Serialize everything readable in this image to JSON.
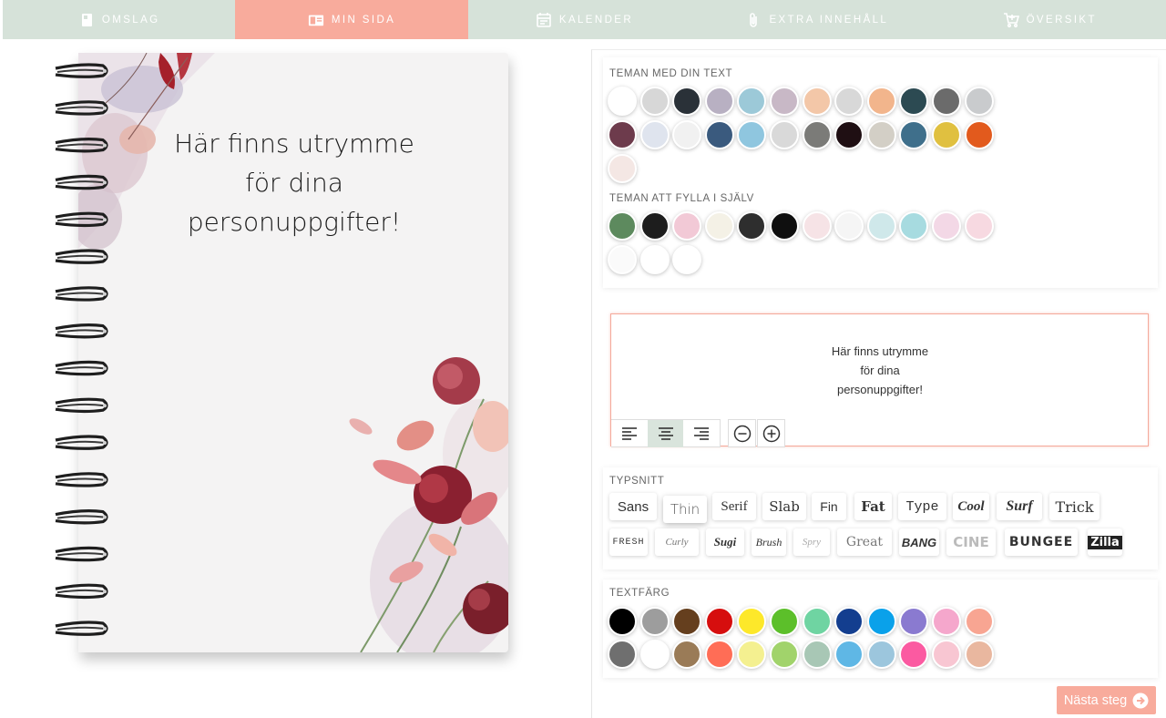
{
  "nav": {
    "tabs": [
      {
        "label": "OMSLAG",
        "icon": "book-icon"
      },
      {
        "label": "MIN SIDA",
        "icon": "page-icon",
        "active": true
      },
      {
        "label": "KALENDER",
        "icon": "calendar-icon"
      },
      {
        "label": "EXTRA INNEHÅLL",
        "icon": "paperclip-icon"
      },
      {
        "label": "ÖVERSIKT",
        "icon": "cart-icon"
      }
    ]
  },
  "notebook": {
    "cover_text": "Här finns utrymme\nför dina\npersonuppgifter!"
  },
  "themes": {
    "with_text_label": "TEMAN MED DIN TEXT",
    "with_text": [
      "#ffffff",
      "#d7d7d7",
      "#2a3138",
      "#b8b0c2",
      "#9cc9d8",
      "#c8b8c6",
      "#f3c7a8",
      "#d8d8d8",
      "#f2b58c",
      "#2c4a52",
      "#6b6b6b",
      "#c9cbcd",
      "#6d3b4c",
      "#dfe4ee",
      "#f1f1f1",
      "#3a5a7e",
      "#8fc6df",
      "#d9d9d9",
      "#7b7b78",
      "#1f0f13",
      "#d3cfc6",
      "#3f6f8b",
      "#e0c040",
      "#e25a1d",
      "#f4e7e4"
    ],
    "fill_in_label": "TEMAN ATT FYLLA I SJÄLV",
    "fill_in": [
      "#5d8a5e",
      "#1d1d1d",
      "#f2c9d6",
      "#f4f1e6",
      "#2e2e2e",
      "#0f0f0f",
      "#f6e3e6",
      "#f5f5f5",
      "#cfe8ea",
      "#a7dbe0",
      "#f3d8e6",
      "#f7d9e1",
      "#fafafa",
      "#ffffff",
      "#ffffff"
    ]
  },
  "editor": {
    "text": "Här finns utrymme\nför dina\npersonuppgifter!",
    "align_buttons": [
      "align-left-icon",
      "align-center-icon",
      "align-right-icon"
    ],
    "active_align": "center",
    "size_buttons": [
      "minus-icon",
      "plus-icon"
    ]
  },
  "fonts": {
    "label": "TYPSNITT",
    "row1": [
      "Sans",
      "Thin",
      "Serif",
      "Slab",
      "Fin",
      "Fat",
      "Type",
      "Cool",
      "Surf",
      "Trick"
    ],
    "row2": [
      "FRESH",
      "Curly",
      "Sugi",
      "Brush",
      "Spry",
      "Great",
      "BANG",
      "CINE",
      "BUNGEE",
      "Zilla"
    ],
    "selected": "Thin"
  },
  "text_colors": {
    "label": "TEXTFÄRG",
    "row1": [
      "#000000",
      "#9d9d9d",
      "#653f1e",
      "#d60e0e",
      "#fde82a",
      "#5cbf2a",
      "#6fd4a2",
      "#133e8f",
      "#0aa1ea",
      "#8a7ad0",
      "#f5a7cc",
      "#f8a592"
    ],
    "row2": [
      "#6f6f6f",
      "#ffffff",
      "#9a7b57",
      "#ff6d56",
      "#f4f090",
      "#a1d36b",
      "#a8c7b5",
      "#5fb7e5",
      "#9cc6dd",
      "#fb5aa1",
      "#f8c6d2",
      "#e9b79f"
    ]
  },
  "next_button": {
    "label": "Nästa steg",
    "icon": "arrow-right-circle-icon"
  },
  "colors": {
    "accent": "#f8ab9c",
    "nav_bg": "#d6e2d9",
    "active_align_bg": "#d9e4dc"
  }
}
